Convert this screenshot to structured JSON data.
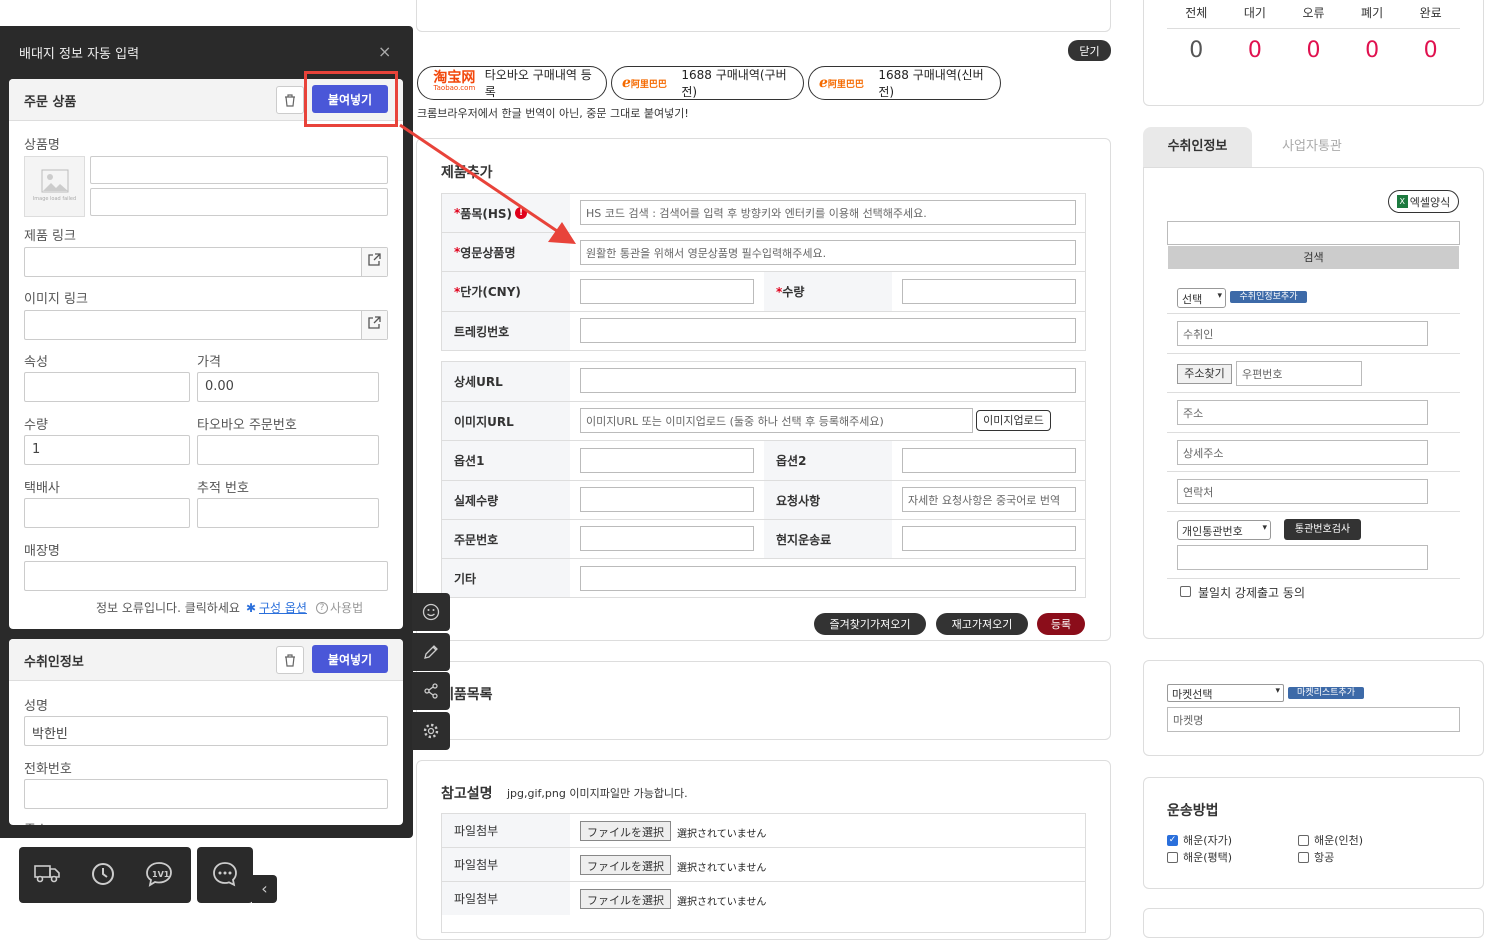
{
  "top_close_button": "닫기",
  "purchase_buttons": {
    "taobao": "타오바오 구매내역 등록",
    "old_1688": "1688 구매내역(구버전)",
    "new_1688": "1688 구매내역(신버전)",
    "taobao_logo": "淘宝网",
    "taobao_logo_sub": "Taobao.com",
    "alibaba_logo": "阿里巴巴"
  },
  "paste_notice": "크롬브라우저에서 한글 번역이 아닌, 중문 그대로 붙여넣기!",
  "product_form": {
    "title": "제품추가",
    "hs_label": "품목(HS)",
    "hs_placeholder": "HS 코드 검색 : 검색어를 입력 후 방향키와 엔터키를 이용해 선택해주세요.",
    "en_name_label": "영문상품명",
    "en_name_placeholder": "원활한 통관을 위해서 영문상품명 필수입력해주세요.",
    "price_label": "단가(CNY)",
    "qty_label": "수량",
    "tracking_label": "트레킹번호",
    "detail_url_label": "상세URL",
    "image_url_label": "이미지URL",
    "image_url_placeholder": "이미지URL 또는 이미지업로드 (둘중 하나 선택 후 등록해주세요)",
    "image_upload_btn": "이미지업로드",
    "option1_label": "옵션1",
    "option2_label": "옵션2",
    "actual_qty_label": "실제수량",
    "request_label": "요청사항",
    "request_placeholder": "자세한 요청사항은 중국어로 번역",
    "order_no_label": "주문번호",
    "local_ship_label": "현지운송료",
    "etc_label": "기타",
    "fav_btn": "즐겨찾기가져오기",
    "stock_btn": "재고가져오기",
    "register_btn": "등록"
  },
  "product_list_title": "제품목록",
  "reference": {
    "title": "참고설명",
    "note": "jpg,gif,png 이미지파일만 가능합니다.",
    "rows": [
      {
        "label": "파일첨부",
        "btn": "ファイルを選択",
        "status": "選択されていません"
      },
      {
        "label": "파일첨부",
        "btn": "ファイルを選択",
        "status": "選択されていません"
      },
      {
        "label": "파일첨부",
        "btn": "ファイルを選択",
        "status": "選択されていません"
      }
    ]
  },
  "status_counts": {
    "headers": [
      "전체",
      "대기",
      "오류",
      "폐기",
      "완료"
    ],
    "values": [
      "0",
      "0",
      "0",
      "0",
      "0"
    ]
  },
  "recipient_panel": {
    "tabs": [
      "수취인정보",
      "사업자통관"
    ],
    "excel_btn": "엑셀양식",
    "search_btn": "검색",
    "select_value": "선택",
    "add_recipient_btn": "수취인정보추가",
    "name_placeholder": "수취인",
    "find_address_btn": "주소찾기",
    "zip_placeholder": "우편번호",
    "address_placeholder": "주소",
    "detail_address_placeholder": "상세주소",
    "contact_placeholder": "연락처",
    "customs_select": "개인통관번호",
    "customs_check_btn": "통관번호검사",
    "mismatch_label": "불일치 강제출고 동의"
  },
  "market_panel": {
    "select_value": "마켓선택",
    "add_btn": "마켓리스트추가",
    "name_placeholder": "마켓명"
  },
  "shipping": {
    "title": "운송방법",
    "options": [
      {
        "label": "해운(자가)",
        "checked": true
      },
      {
        "label": "해운(인천)",
        "checked": false
      },
      {
        "label": "해운(평택)",
        "checked": false
      },
      {
        "label": "항공",
        "checked": false
      }
    ]
  },
  "overlay": {
    "title": "배대지 정보 자동 입력",
    "order_card": {
      "title": "주문 상품",
      "paste_btn": "붙여넣기",
      "image_placeholder": "Image load failed",
      "product_name_label": "상품명",
      "product_link_label": "제품 링크",
      "image_link_label": "이미지 링크",
      "attr_label": "속성",
      "price_label": "가격",
      "price_value": "0.00",
      "qty_label": "수량",
      "qty_value": "1",
      "taobao_order_label": "타오바오 주문번호",
      "courier_label": "택배사",
      "tracking_label": "추적 번호",
      "store_label": "매장명",
      "error_text": "정보 오류입니다. 클릭하세요",
      "config_link": "구성 옵션",
      "usage_link": "사용법"
    },
    "recipient_card": {
      "title": "수취인정보",
      "paste_btn": "붙여넣기",
      "name_label": "성명",
      "name_value": "박한빈",
      "phone_label": "전화번호",
      "address_label": "주소"
    }
  }
}
